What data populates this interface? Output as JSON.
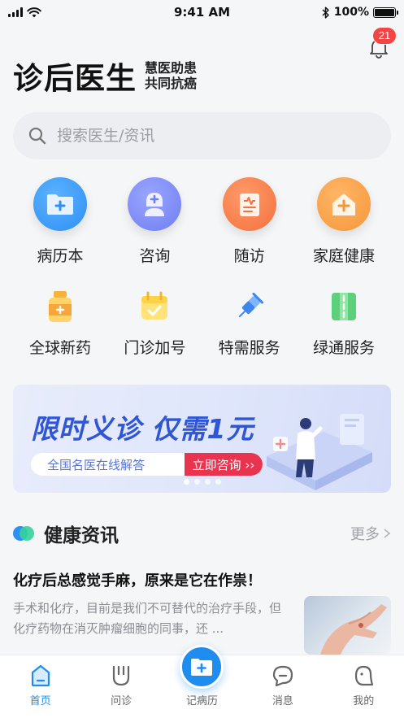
{
  "status_bar": {
    "time": "9:41 AM",
    "battery": "100%"
  },
  "notifications": {
    "count": "21"
  },
  "brand": {
    "title": "诊后医生",
    "slogan_line1": "慧医助患",
    "slogan_line2": "共同抗癌"
  },
  "search": {
    "placeholder": "搜索医生/资讯"
  },
  "main_services": [
    {
      "label": "病历本",
      "icon": "folder-plus-icon",
      "color": "#2f8ff3"
    },
    {
      "label": "咨询",
      "icon": "doctor-icon",
      "color": "#6f7ef2"
    },
    {
      "label": "随访",
      "icon": "clipboard-icon",
      "color": "#f4713c"
    },
    {
      "label": "家庭健康",
      "icon": "house-plus-icon",
      "color": "#f6963a"
    }
  ],
  "sub_services": [
    {
      "label": "全球新药",
      "icon": "medicine-bottle-icon"
    },
    {
      "label": "门诊加号",
      "icon": "calendar-check-icon"
    },
    {
      "label": "特需服务",
      "icon": "syringe-icon"
    },
    {
      "label": "绿通服务",
      "icon": "green-road-icon"
    }
  ],
  "banner": {
    "headline": "限时义诊 仅需1元",
    "pill_text": "全国名医在线解答",
    "button_label": "立即咨询 ››",
    "slide_count": 4,
    "active_slide": 1
  },
  "news": {
    "section_title": "健康资讯",
    "more_label": "更多",
    "article": {
      "title": "化疗后总感觉手麻，原来是它在作祟！",
      "summary": "手术和化疗，目前是我们不可替代的治疗手段，但化疗药物在消灭肿瘤细胞的同事，还 ..."
    }
  },
  "tabbar": {
    "items": [
      {
        "label": "首页",
        "icon": "home-icon",
        "active": true
      },
      {
        "label": "问诊",
        "icon": "stethoscope-icon",
        "active": false
      },
      {
        "label": "记病历",
        "icon": "folder-plus-icon",
        "active": false
      },
      {
        "label": "消息",
        "icon": "message-icon",
        "active": false
      },
      {
        "label": "我的",
        "icon": "profile-icon",
        "active": false
      }
    ]
  },
  "colors": {
    "accent": "#1f8df0",
    "badge": "#f24545",
    "banner_button": "#e8344e",
    "banner_text": "#2f56d6"
  }
}
